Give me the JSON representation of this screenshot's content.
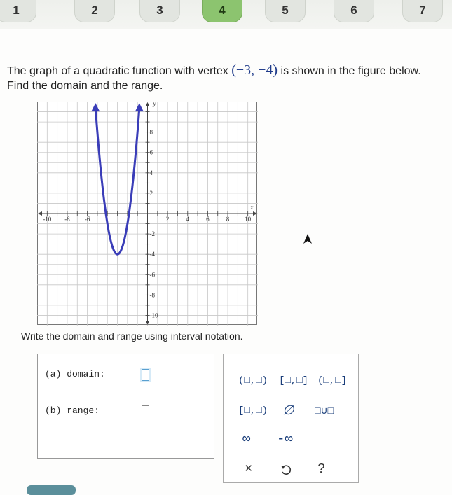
{
  "steps": [
    "1",
    "2",
    "3",
    "4",
    "5",
    "6",
    "7"
  ],
  "question": {
    "line1_before": "The graph of a quadratic function with vertex ",
    "vertex": "(−3, −4)",
    "line1_after": " is shown in the figure below.",
    "line2": "Find the domain and the range."
  },
  "graph": {
    "x_ticks": [
      "-10",
      "-8",
      "-6",
      "2",
      "4",
      "6",
      "8",
      "10"
    ],
    "y_ticks_pos": [
      "8",
      "6",
      "4",
      "2"
    ],
    "y_ticks_neg": [
      "-2",
      "-4",
      "-6",
      "-8",
      "-10"
    ],
    "x_axis_label": "x",
    "y_axis_label": "y",
    "curve_color": "#3a3db8",
    "vertex_x": -3,
    "vertex_y": -4,
    "leading_coefficient": 3
  },
  "instructions": "Write the domain and range using interval notation.",
  "answers": {
    "domain_label": "(a)  domain:",
    "domain_value": "",
    "range_label": "(b)  range:",
    "range_value": ""
  },
  "keypad": {
    "open_open": "(□,□)",
    "closed_closed": "[□,□]",
    "open_closed": "(□,□]",
    "closed_open": "[□,□)",
    "empty_set": "∅",
    "union": "□∪□",
    "infinity": "∞",
    "neg_infinity": "-∞",
    "clear": "×",
    "undo_icon": "undo-icon",
    "help": "?"
  }
}
